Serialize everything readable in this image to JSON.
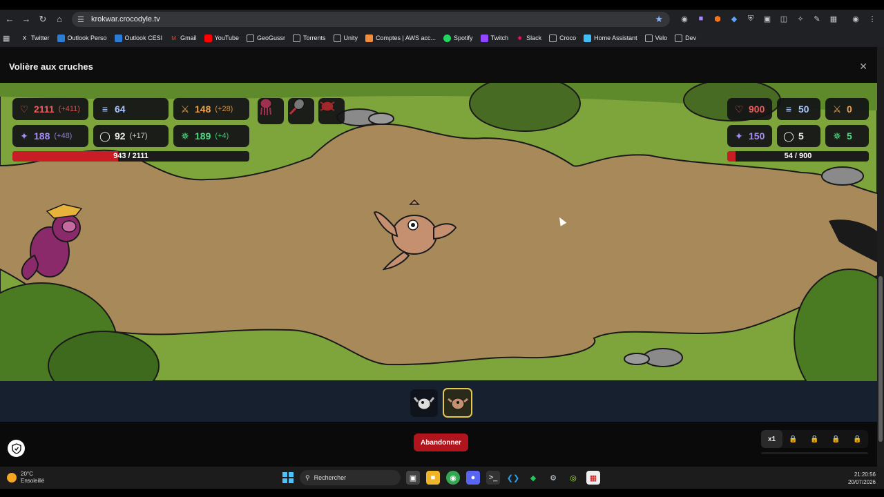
{
  "browser": {
    "url": "krokwar.crocodyle.tv",
    "bookmarks": [
      "Twitter",
      "Outlook Perso",
      "Outlook CESI",
      "Gmail",
      "YouTube",
      "GeoGussr",
      "Torrents",
      "Unity",
      "Comptes | AWS acc...",
      "Spotify",
      "Twitch",
      "Slack",
      "Croco",
      "Home Assistant",
      "Velo",
      "Dev"
    ]
  },
  "modal": {
    "title": "Volière aux cruches",
    "close_icon": "close-icon"
  },
  "player": {
    "stats": {
      "hp": "2111",
      "hp_bonus": "(+411)",
      "speed": "64",
      "attack": "148",
      "attack_bonus": "(+28)",
      "magic": "188",
      "magic_bonus": "(+48)",
      "defense": "92",
      "defense_bonus": "(+17)",
      "agility": "189",
      "agility_bonus": "(+4)"
    },
    "health_text": "943 / 2111",
    "health_fraction": 0.4467,
    "items": [
      "jellyfish-item-icon",
      "racket-item-icon",
      "beetle-item-icon"
    ]
  },
  "enemy": {
    "stats": {
      "hp": "900",
      "speed": "50",
      "attack": "0",
      "magic": "150",
      "defense": "5",
      "agility": "5"
    },
    "health_text": "54 / 900",
    "health_fraction": 0.06
  },
  "creatures": [
    "owl-creature-icon",
    "bird-creature-icon"
  ],
  "footer": {
    "abandon_label": "Abandonner",
    "speed_options": [
      "x1",
      "",
      "",
      "",
      ""
    ],
    "selected_speed": "x1"
  },
  "taskbar": {
    "temperature": "20°C",
    "weather": "Ensoleillé",
    "search_placeholder": "Rechercher",
    "time": "21:20:56",
    "date": "20/07/2026"
  },
  "colors": {
    "accent_red": "#c81d25",
    "active_slot": "#e8c84a",
    "arena_path": "#a88a5a",
    "grass": "#7ea43c"
  }
}
